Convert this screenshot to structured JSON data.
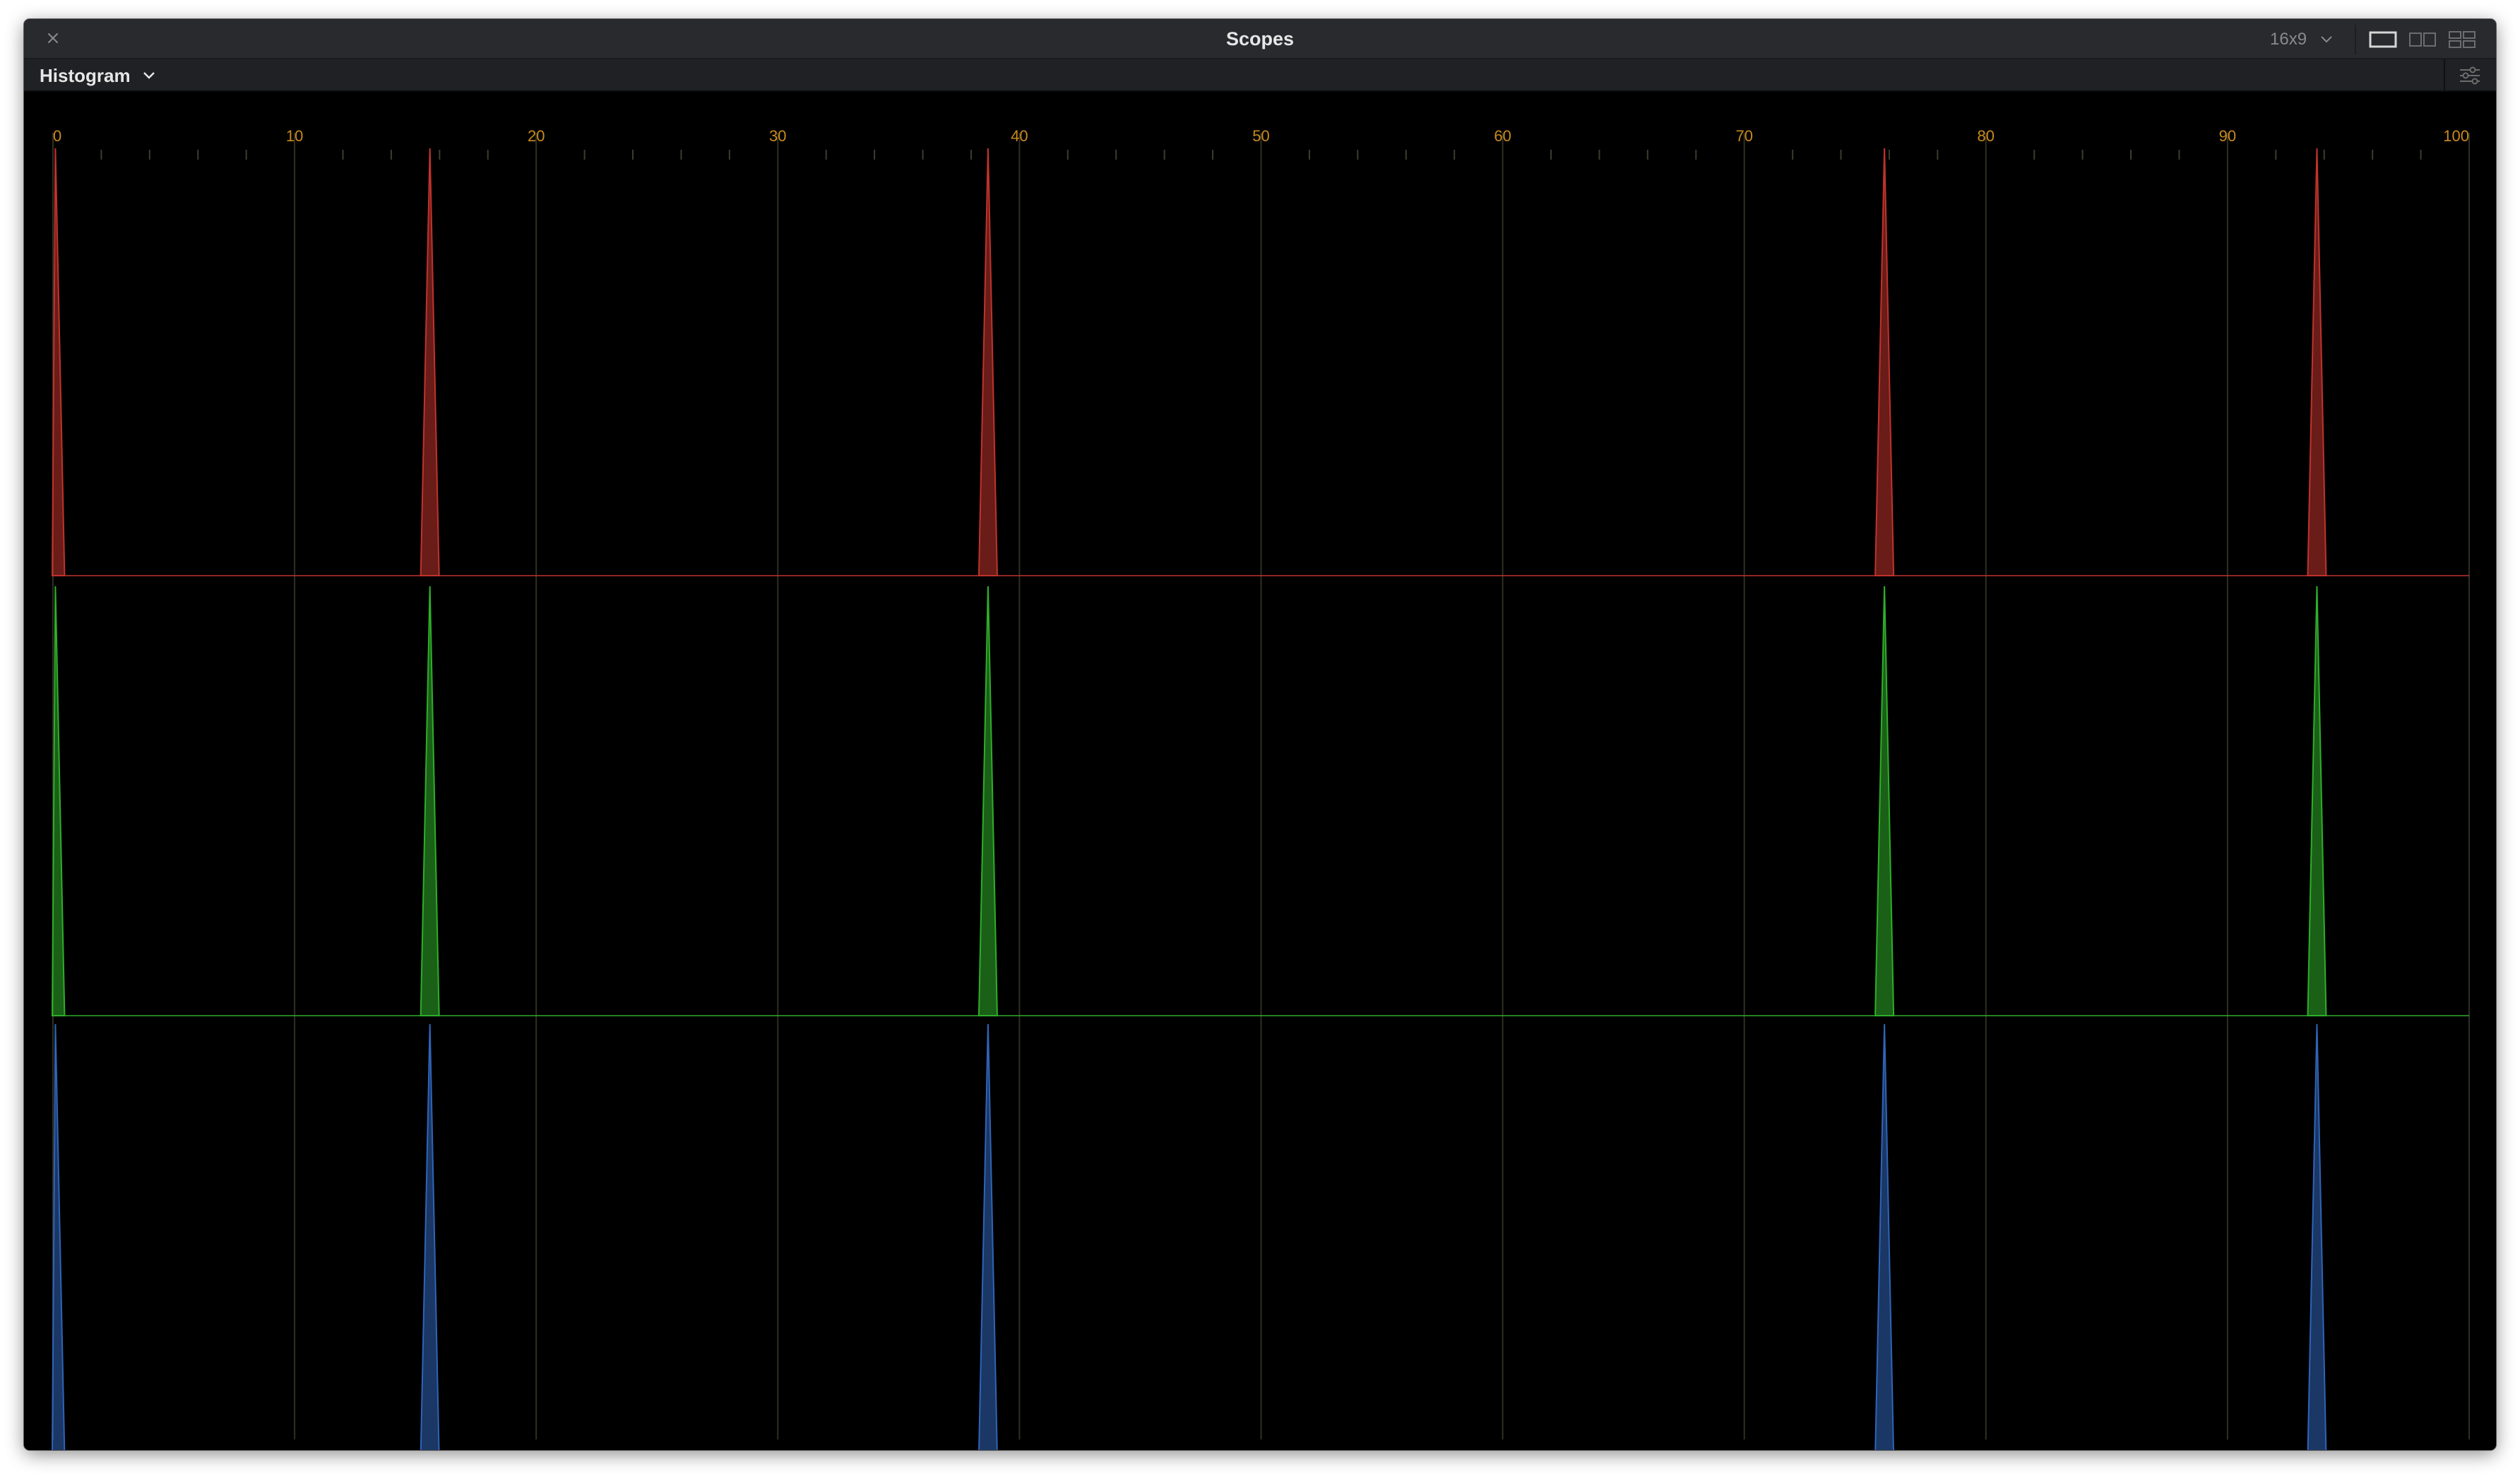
{
  "window": {
    "title": "Scopes",
    "aspect": "16x9"
  },
  "toolbar": {
    "scope_type": "Histogram"
  },
  "colors": {
    "red_channel": "#c0332c",
    "green_channel": "#2fae2a",
    "blue_channel": "#2f64b8",
    "tick_label": "#c98a1e"
  },
  "icons": {
    "close": "close-icon",
    "aspect_dropdown": "chevron-down-icon",
    "single_layout": "single-layout-icon",
    "dual_layout": "dual-layout-icon",
    "quad_layout": "quad-layout-icon",
    "scope_dropdown": "chevron-down-icon",
    "settings": "settings-sliders-icon"
  },
  "chart_data": {
    "type": "area",
    "title": "",
    "xlabel": "",
    "ylabel": "",
    "xlim": [
      0,
      100
    ],
    "x_ticks": [
      "0",
      "10",
      "20",
      "30",
      "40",
      "50",
      "60",
      "70",
      "80",
      "90",
      "100"
    ],
    "series": [
      {
        "name": "",
        "channel": "red",
        "peaks_x": [
          0.1,
          15.6,
          38.7,
          75.8,
          93.7
        ],
        "peak_heights": [
          1,
          1,
          1,
          1,
          1
        ]
      },
      {
        "name": "",
        "channel": "green",
        "peaks_x": [
          0.1,
          15.6,
          38.7,
          75.8,
          93.7
        ],
        "peak_heights": [
          1,
          1,
          1,
          1,
          1
        ]
      },
      {
        "name": "",
        "channel": "blue",
        "peaks_x": [
          0.1,
          15.6,
          38.7,
          75.8,
          93.7
        ],
        "peak_heights": [
          1,
          1,
          1,
          1,
          1
        ]
      }
    ],
    "grid": true
  }
}
